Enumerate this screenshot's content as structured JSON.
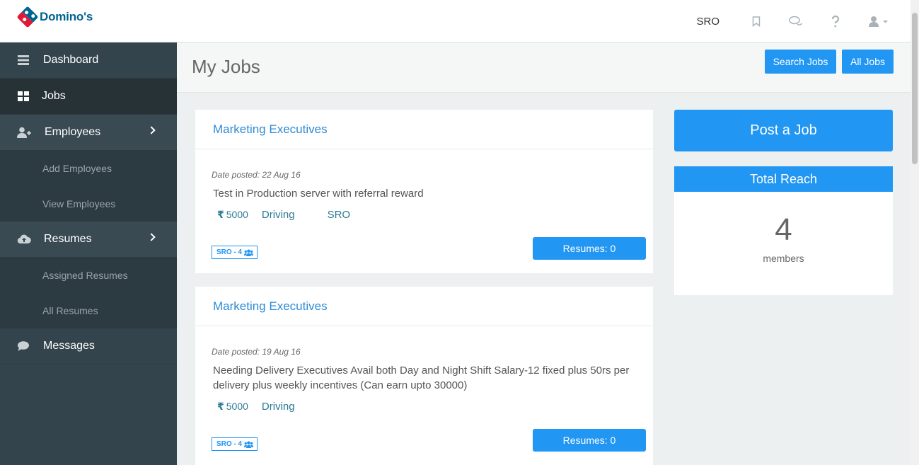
{
  "brand": {
    "name": "Domino's"
  },
  "topbar": {
    "user_label": "SRO"
  },
  "sidebar": {
    "items": [
      {
        "label": "Dashboard"
      },
      {
        "label": "Jobs"
      },
      {
        "label": "Employees"
      },
      {
        "label": "Add Employees"
      },
      {
        "label": "View Employees"
      },
      {
        "label": "Resumes"
      },
      {
        "label": "Assigned Resumes"
      },
      {
        "label": "All Resumes"
      },
      {
        "label": "Messages"
      }
    ]
  },
  "header": {
    "title": "My Jobs",
    "search_jobs_label": "Search Jobs",
    "all_jobs_label": "All Jobs"
  },
  "jobs": [
    {
      "title": "Marketing Executives",
      "date": "Date posted: 22 Aug 16",
      "description": "Test in Production server with referral reward",
      "currency": "₹",
      "salary": "5000",
      "category": "Driving",
      "location": "SRO",
      "reach_badge": "SRO - 4",
      "resumes_label": "Resumes: 0"
    },
    {
      "title": "Marketing Executives",
      "date": "Date posted: 19 Aug 16",
      "description": "Needing Delivery Executives Avail both Day and Night Shift Salary-12 fixed plus 50rs per delivery plus weekly incentives (Can earn upto 30000)",
      "currency": "₹",
      "salary": "5000",
      "category": "Driving",
      "reach_badge": "SRO - 4",
      "resumes_label": "Resumes: 0"
    }
  ],
  "right": {
    "post_job_label": "Post a Job",
    "reach_title": "Total Reach",
    "reach_count": "4",
    "reach_unit": "members"
  },
  "colors": {
    "accent": "#2196f3",
    "sidebar": "#34444c",
    "brand_blue": "#006491",
    "brand_red": "#e31837"
  }
}
